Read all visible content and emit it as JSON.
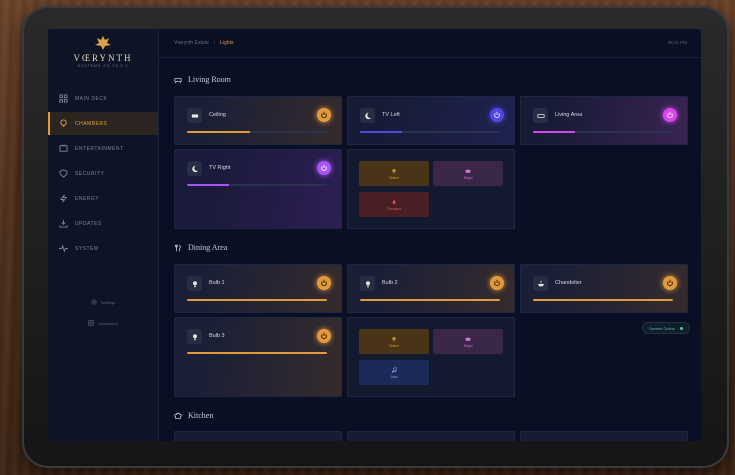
{
  "colors": {
    "accent": "#e39a3b",
    "purple": "#a855f7",
    "blue": "#4f46e5",
    "pink": "#d946ef",
    "red": "#7a2e2e"
  },
  "logo": {
    "name": "VŒRYNTH",
    "subtitle": "SYSTEMS OS V5.0.1",
    "icon": "crown-griffin-icon"
  },
  "nav": [
    {
      "label": "MAIN DECK",
      "icon": "grid-icon"
    },
    {
      "label": "CHAMBERS",
      "icon": "bulb-icon",
      "active": true
    },
    {
      "label": "ENTERTAINMENT",
      "icon": "tv-icon"
    },
    {
      "label": "SECURITY",
      "icon": "shield-icon"
    },
    {
      "label": "ENERGY",
      "icon": "bolt-icon"
    },
    {
      "label": "UPDATES",
      "icon": "download-icon"
    },
    {
      "label": "SYSTEM",
      "icon": "pulse-icon"
    }
  ],
  "utility": {
    "settings": "Settings",
    "dashboard": "Dashboard"
  },
  "breadcrumb": {
    "root": "Vœrynth Estate",
    "separator": "/",
    "current": "Lights"
  },
  "clock": "05:41 PM",
  "sections": {
    "living_room": "Living Room",
    "dining_area": "Dining Area",
    "kitchen": "Kitchen"
  },
  "living_room": {
    "lights": [
      {
        "name": "Ceiling",
        "level": 0.45,
        "color": "#e39a3b"
      },
      {
        "name": "TV Left",
        "level": 0.3,
        "color": "#4f46e5"
      },
      {
        "name": "Living Area",
        "level": 0.3,
        "color": "#d946ef"
      },
      {
        "name": "TV Right",
        "level": 0.3,
        "color": "#a855f7"
      }
    ],
    "scenes": {
      "warm": "Warm",
      "tokyo": "Tokyo",
      "fireplace": "Fireplace"
    }
  },
  "dining_area": {
    "lights": [
      {
        "name": "Bulb 1",
        "level": 1.0,
        "color": "#e39a3b"
      },
      {
        "name": "Bulb 2",
        "level": 1.0,
        "color": "#e39a3b"
      },
      {
        "name": "Chandelier",
        "level": 1.0,
        "color": "#e39a3b"
      },
      {
        "name": "Bulb 3",
        "level": 1.0,
        "color": "#e39a3b"
      }
    ],
    "scenes": {
      "warm": "Warm",
      "tokyo": "Tokyo",
      "jazz": "Jazz"
    }
  },
  "status": {
    "label": "System Online"
  }
}
